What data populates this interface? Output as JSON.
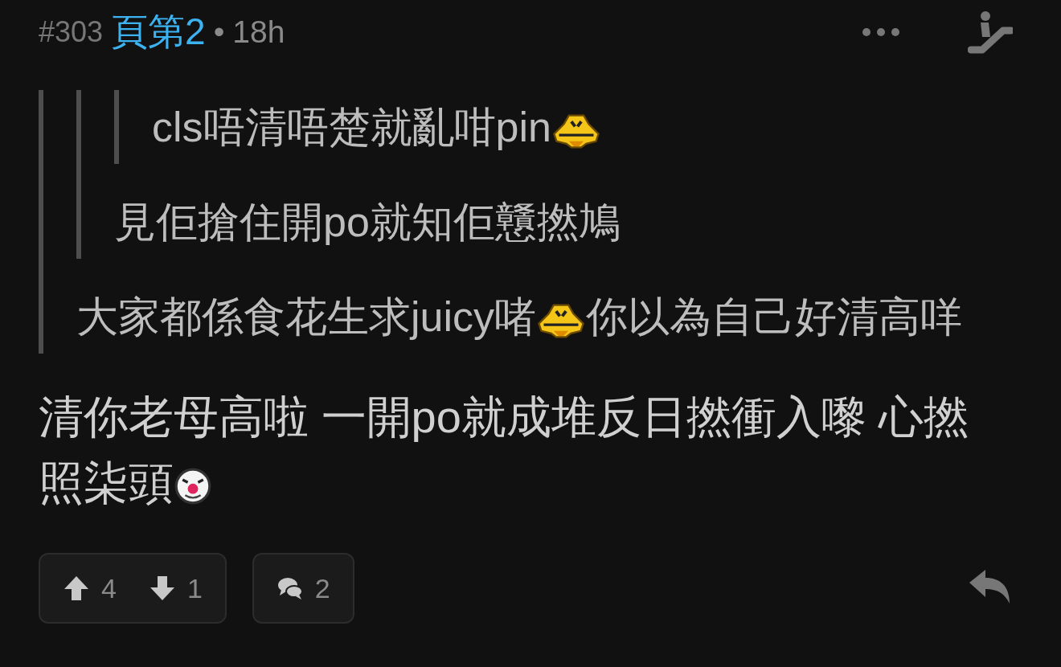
{
  "post": {
    "number": "#303",
    "author": "頁第2",
    "separator": "•",
    "time": "18h"
  },
  "quote": {
    "quote": {
      "quote": {
        "segments": [
          {
            "kind": "text",
            "text": "cls唔清唔楚就亂咁pin"
          },
          {
            "kind": "grin"
          }
        ]
      },
      "segments": [
        {
          "kind": "text",
          "text": "見佢搶住開po就知佢戇撚鳩"
        }
      ]
    },
    "segments": [
      {
        "kind": "text",
        "text": "大家都係食花生求juicy啫"
      },
      {
        "kind": "grin"
      },
      {
        "kind": "text",
        "text": "你以為自己好清高咩"
      }
    ]
  },
  "body": [
    {
      "kind": "text",
      "text": "清你老母高啦 一開po就成堆反日撚衝入嚟 心撚"
    },
    {
      "kind": "text",
      "text": "照柒頭"
    },
    {
      "kind": "clown"
    }
  ],
  "votes": {
    "up": "4",
    "down": "1"
  },
  "replies": "2"
}
